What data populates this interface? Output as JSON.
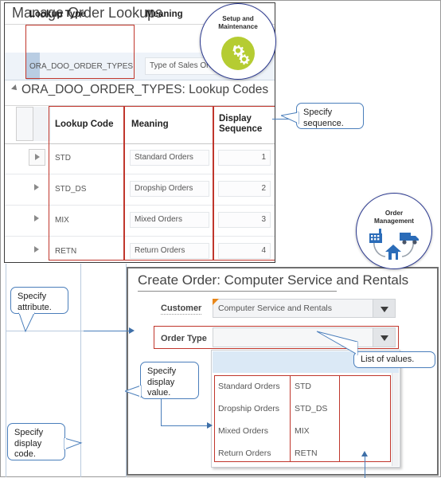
{
  "top_panel": {
    "title": "Manage Order Lookups",
    "lookup_header": [
      {
        "label": "Lookup Type"
      },
      {
        "label": "Meaning"
      }
    ],
    "lookup_row": {
      "lookup_type": "ORA_DOO_ORDER_TYPES",
      "meaning": "Type of Sales Ord"
    },
    "section_title": "ORA_DOO_ORDER_TYPES: Lookup Codes",
    "grid_headers": [
      "Lookup Code",
      "Meaning",
      "Display Sequence"
    ],
    "grid_rows": [
      {
        "code": "STD",
        "meaning": "Standard Orders",
        "sequence": "1"
      },
      {
        "code": "STD_DS",
        "meaning": "Dropship Orders",
        "sequence": "2"
      },
      {
        "code": "MIX",
        "meaning": "Mixed Orders",
        "sequence": "3"
      },
      {
        "code": "RETN",
        "meaning": "Return Orders",
        "sequence": "4"
      }
    ]
  },
  "bottom_panel": {
    "title": "Create Order: Computer Service and Rentals",
    "customer_label": "Customer",
    "customer_value": "Computer Service and Rentals",
    "order_type_label": "Order Type",
    "order_type_value": "",
    "dropdown_rows": [
      {
        "meaning": "Standard Orders",
        "code": "STD"
      },
      {
        "meaning": "Dropship Orders",
        "code": "STD_DS"
      },
      {
        "meaning": "Mixed Orders",
        "code": "MIX"
      },
      {
        "meaning": "Return Orders",
        "code": "RETN"
      }
    ]
  },
  "badges": {
    "setup": {
      "line1": "Setup and",
      "line2": "Maintenance"
    },
    "order_mgmt": {
      "line1": "Order",
      "line2": "Management"
    }
  },
  "callouts": {
    "sequence": "Specify sequence.",
    "attribute": "Specify attribute.",
    "display_value": "Specify display value.",
    "display_code": "Specify display code.",
    "list_of_values": "List of values."
  },
  "colors": {
    "highlight_red": "#c0362c",
    "connector_blue": "#4a7ebb",
    "badge_ring": "#2b3990",
    "gear_green": "#b5cc32",
    "required_orange": "#e8871a"
  }
}
